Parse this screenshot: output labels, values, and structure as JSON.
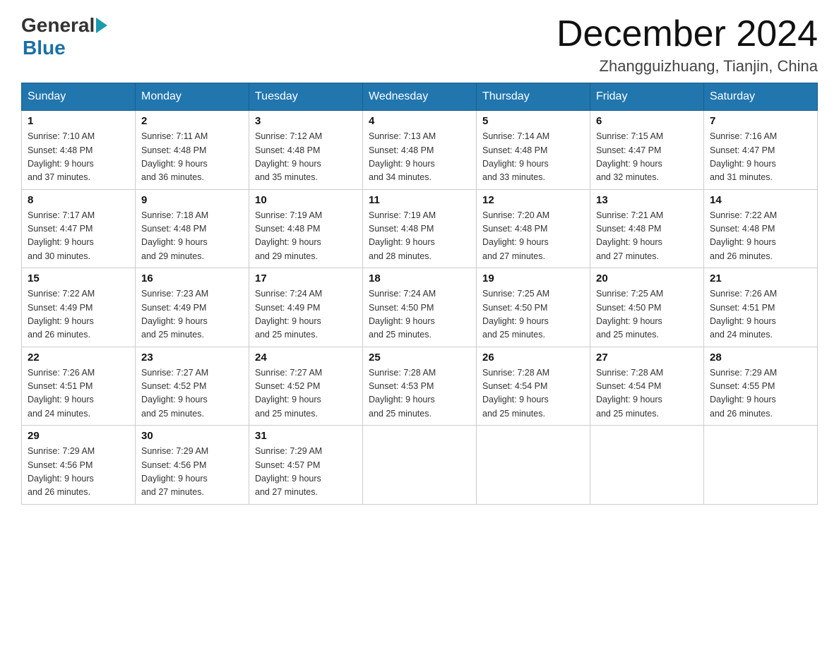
{
  "header": {
    "logo_general": "General",
    "logo_blue": "Blue",
    "month_title": "December 2024",
    "location": "Zhangguizhuang, Tianjin, China"
  },
  "weekdays": [
    "Sunday",
    "Monday",
    "Tuesday",
    "Wednesday",
    "Thursday",
    "Friday",
    "Saturday"
  ],
  "weeks": [
    [
      {
        "day": "1",
        "sunrise": "7:10 AM",
        "sunset": "4:48 PM",
        "daylight": "9 hours and 37 minutes."
      },
      {
        "day": "2",
        "sunrise": "7:11 AM",
        "sunset": "4:48 PM",
        "daylight": "9 hours and 36 minutes."
      },
      {
        "day": "3",
        "sunrise": "7:12 AM",
        "sunset": "4:48 PM",
        "daylight": "9 hours and 35 minutes."
      },
      {
        "day": "4",
        "sunrise": "7:13 AM",
        "sunset": "4:48 PM",
        "daylight": "9 hours and 34 minutes."
      },
      {
        "day": "5",
        "sunrise": "7:14 AM",
        "sunset": "4:48 PM",
        "daylight": "9 hours and 33 minutes."
      },
      {
        "day": "6",
        "sunrise": "7:15 AM",
        "sunset": "4:47 PM",
        "daylight": "9 hours and 32 minutes."
      },
      {
        "day": "7",
        "sunrise": "7:16 AM",
        "sunset": "4:47 PM",
        "daylight": "9 hours and 31 minutes."
      }
    ],
    [
      {
        "day": "8",
        "sunrise": "7:17 AM",
        "sunset": "4:47 PM",
        "daylight": "9 hours and 30 minutes."
      },
      {
        "day": "9",
        "sunrise": "7:18 AM",
        "sunset": "4:48 PM",
        "daylight": "9 hours and 29 minutes."
      },
      {
        "day": "10",
        "sunrise": "7:19 AM",
        "sunset": "4:48 PM",
        "daylight": "9 hours and 29 minutes."
      },
      {
        "day": "11",
        "sunrise": "7:19 AM",
        "sunset": "4:48 PM",
        "daylight": "9 hours and 28 minutes."
      },
      {
        "day": "12",
        "sunrise": "7:20 AM",
        "sunset": "4:48 PM",
        "daylight": "9 hours and 27 minutes."
      },
      {
        "day": "13",
        "sunrise": "7:21 AM",
        "sunset": "4:48 PM",
        "daylight": "9 hours and 27 minutes."
      },
      {
        "day": "14",
        "sunrise": "7:22 AM",
        "sunset": "4:48 PM",
        "daylight": "9 hours and 26 minutes."
      }
    ],
    [
      {
        "day": "15",
        "sunrise": "7:22 AM",
        "sunset": "4:49 PM",
        "daylight": "9 hours and 26 minutes."
      },
      {
        "day": "16",
        "sunrise": "7:23 AM",
        "sunset": "4:49 PM",
        "daylight": "9 hours and 25 minutes."
      },
      {
        "day": "17",
        "sunrise": "7:24 AM",
        "sunset": "4:49 PM",
        "daylight": "9 hours and 25 minutes."
      },
      {
        "day": "18",
        "sunrise": "7:24 AM",
        "sunset": "4:50 PM",
        "daylight": "9 hours and 25 minutes."
      },
      {
        "day": "19",
        "sunrise": "7:25 AM",
        "sunset": "4:50 PM",
        "daylight": "9 hours and 25 minutes."
      },
      {
        "day": "20",
        "sunrise": "7:25 AM",
        "sunset": "4:50 PM",
        "daylight": "9 hours and 25 minutes."
      },
      {
        "day": "21",
        "sunrise": "7:26 AM",
        "sunset": "4:51 PM",
        "daylight": "9 hours and 24 minutes."
      }
    ],
    [
      {
        "day": "22",
        "sunrise": "7:26 AM",
        "sunset": "4:51 PM",
        "daylight": "9 hours and 24 minutes."
      },
      {
        "day": "23",
        "sunrise": "7:27 AM",
        "sunset": "4:52 PM",
        "daylight": "9 hours and 25 minutes."
      },
      {
        "day": "24",
        "sunrise": "7:27 AM",
        "sunset": "4:52 PM",
        "daylight": "9 hours and 25 minutes."
      },
      {
        "day": "25",
        "sunrise": "7:28 AM",
        "sunset": "4:53 PM",
        "daylight": "9 hours and 25 minutes."
      },
      {
        "day": "26",
        "sunrise": "7:28 AM",
        "sunset": "4:54 PM",
        "daylight": "9 hours and 25 minutes."
      },
      {
        "day": "27",
        "sunrise": "7:28 AM",
        "sunset": "4:54 PM",
        "daylight": "9 hours and 25 minutes."
      },
      {
        "day": "28",
        "sunrise": "7:29 AM",
        "sunset": "4:55 PM",
        "daylight": "9 hours and 26 minutes."
      }
    ],
    [
      {
        "day": "29",
        "sunrise": "7:29 AM",
        "sunset": "4:56 PM",
        "daylight": "9 hours and 26 minutes."
      },
      {
        "day": "30",
        "sunrise": "7:29 AM",
        "sunset": "4:56 PM",
        "daylight": "9 hours and 27 minutes."
      },
      {
        "day": "31",
        "sunrise": "7:29 AM",
        "sunset": "4:57 PM",
        "daylight": "9 hours and 27 minutes."
      },
      null,
      null,
      null,
      null
    ]
  ],
  "labels": {
    "sunrise": "Sunrise:",
    "sunset": "Sunset:",
    "daylight": "Daylight:"
  }
}
